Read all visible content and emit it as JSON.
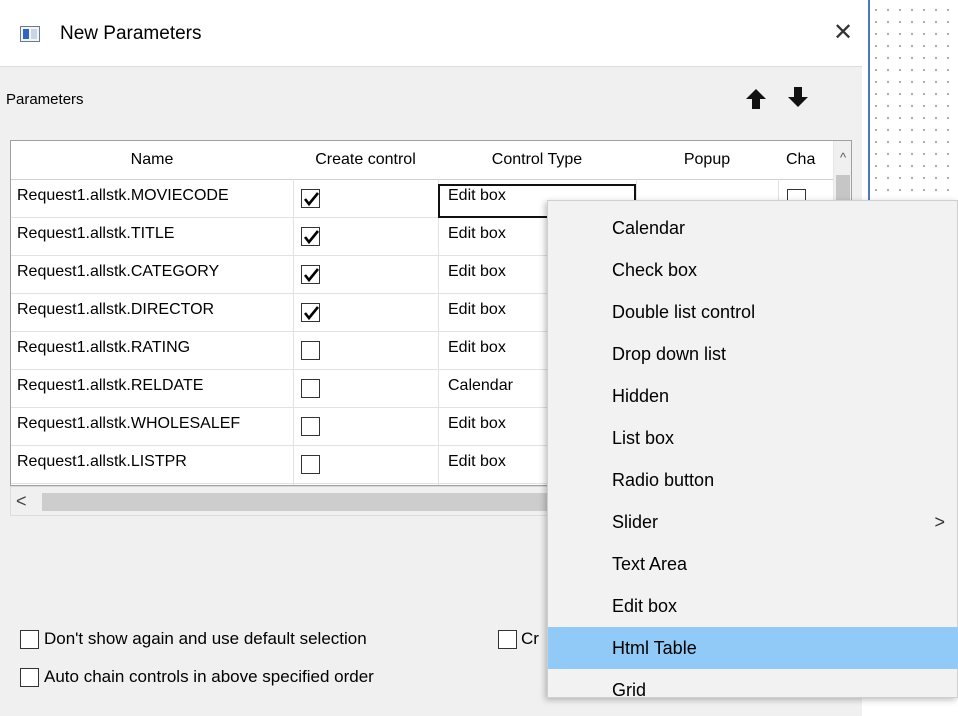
{
  "dialog": {
    "title": "New Parameters",
    "close": "✕"
  },
  "section": {
    "label": "Parameters"
  },
  "table": {
    "columns": [
      "Name",
      "Create control",
      "Control Type",
      "Popup",
      "Cha"
    ],
    "rows": [
      {
        "name": "Request1.allstk.MOVIECODE",
        "create": true,
        "type": "Edit box"
      },
      {
        "name": "Request1.allstk.TITLE",
        "create": true,
        "type": "Edit box"
      },
      {
        "name": "Request1.allstk.CATEGORY",
        "create": true,
        "type": "Edit box"
      },
      {
        "name": "Request1.allstk.DIRECTOR",
        "create": true,
        "type": "Edit box"
      },
      {
        "name": "Request1.allstk.RATING",
        "create": false,
        "type": "Edit box"
      },
      {
        "name": "Request1.allstk.RELDATE",
        "create": false,
        "type": "Calendar"
      },
      {
        "name": "Request1.allstk.WHOLESALEF",
        "create": false,
        "type": "Edit box"
      },
      {
        "name": "Request1.allstk.LISTPR",
        "create": false,
        "type": "Edit box"
      }
    ],
    "scroll_up": "^",
    "scroll_left": "<"
  },
  "options": {
    "dont_show": "Don't show again and use default selection",
    "cut_off": "Cr",
    "auto_chain": "Auto chain controls in above specified order"
  },
  "context_menu": {
    "items": [
      "Calendar",
      "Check box",
      "Double list control",
      "Drop down list",
      "Hidden",
      "List box",
      "Radio button",
      "Slider",
      "Text Area",
      "Edit box",
      "Html Table",
      "Grid"
    ],
    "highlighted": "Html Table",
    "submenu_arrow": ">"
  },
  "colors": {
    "menu_highlight": "#91c9f7",
    "canvas_border": "#4a78c2"
  }
}
